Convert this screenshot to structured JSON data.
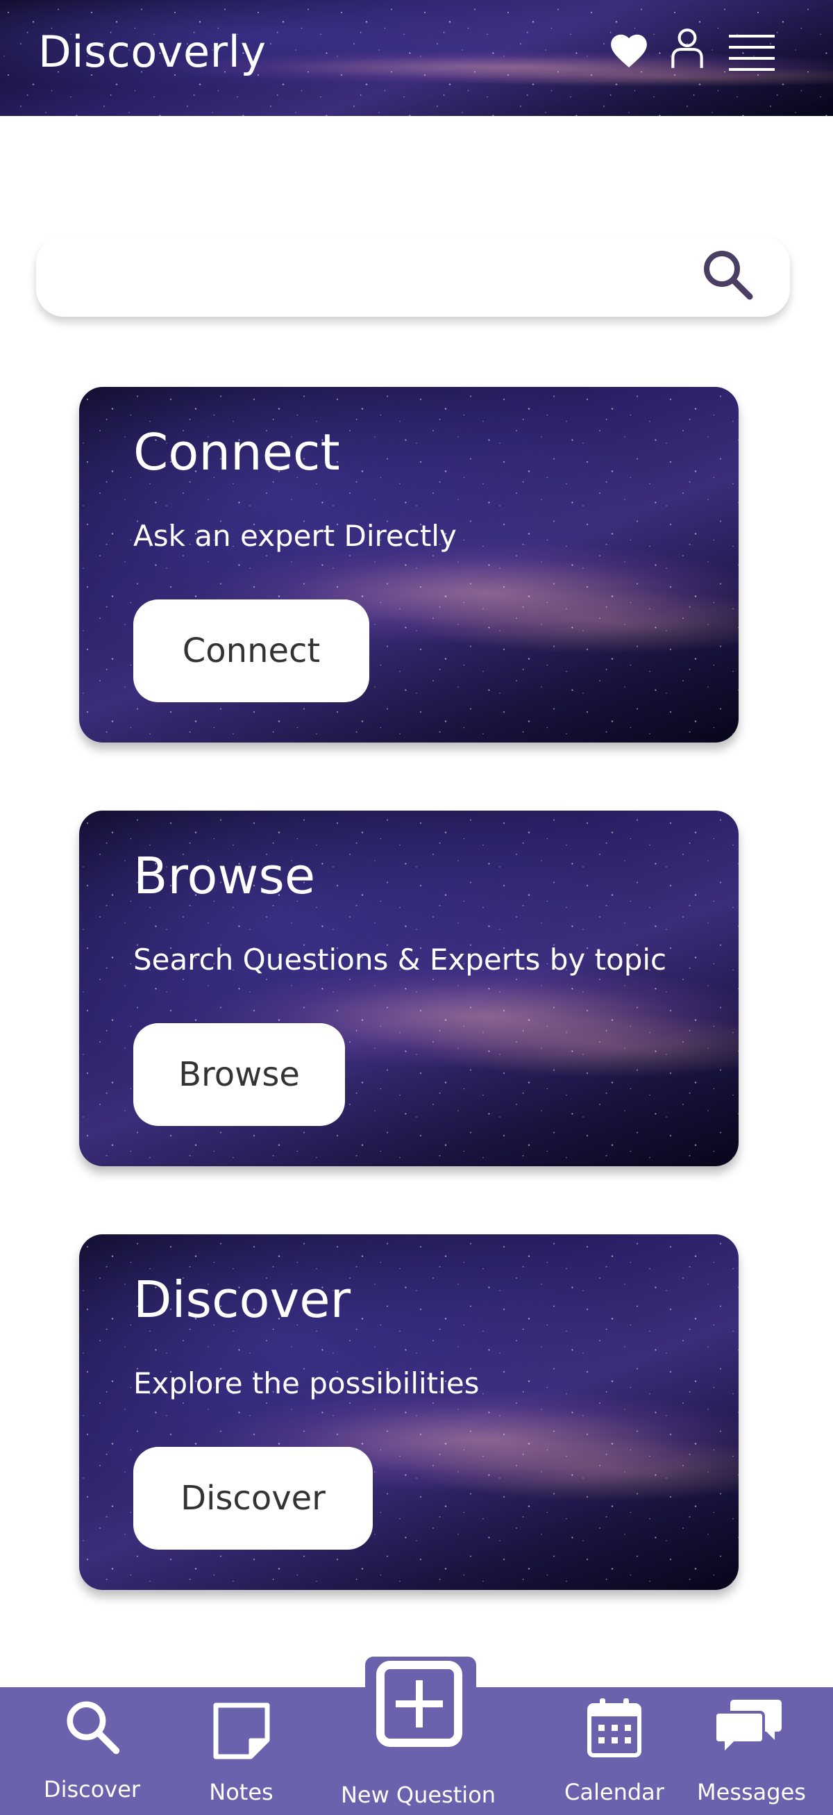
{
  "app": {
    "title": "Discoverly"
  },
  "header": {
    "icons": [
      "heart-icon",
      "user-icon",
      "menu-icon"
    ]
  },
  "search": {
    "placeholder": "",
    "value": "",
    "icon": "search-icon"
  },
  "cards": [
    {
      "title": "Connect",
      "subtitle": "Ask an expert Directly",
      "button": "Connect"
    },
    {
      "title": "Browse",
      "subtitle": "Search Questions & Experts by topic",
      "button": "Browse"
    },
    {
      "title": "Discover",
      "subtitle": "Explore the possibilities",
      "button": "Discover"
    }
  ],
  "nav": {
    "items": [
      {
        "label": "Discover",
        "icon": "search-icon"
      },
      {
        "label": "Notes",
        "icon": "note-icon"
      },
      {
        "label": "New Question",
        "icon": "plus-icon"
      },
      {
        "label": "Calendar",
        "icon": "calendar-icon"
      },
      {
        "label": "Messages",
        "icon": "messages-icon"
      }
    ]
  },
  "colors": {
    "nav_background": "#6b62ad",
    "card_button_background": "#ffffff",
    "search_icon": "#4a3f63"
  }
}
